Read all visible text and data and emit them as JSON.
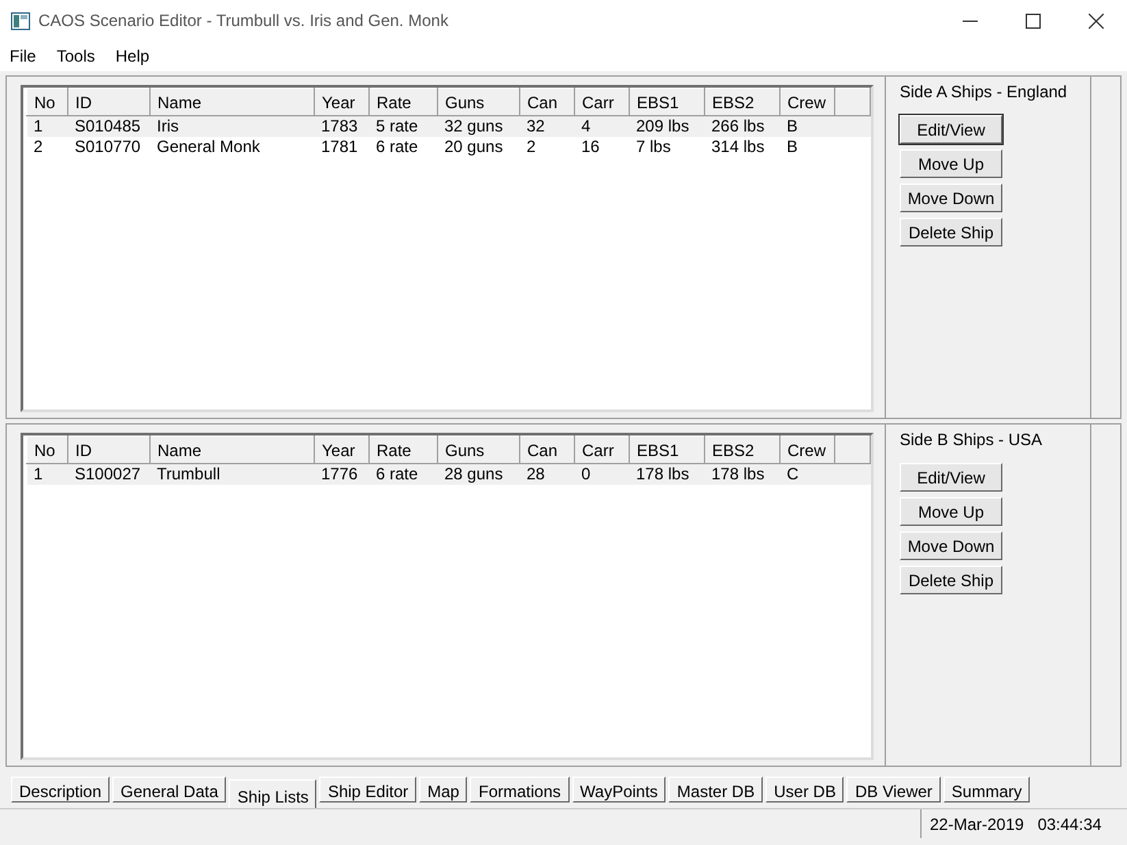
{
  "window": {
    "title": "CAOS Scenario Editor - Trumbull vs. Iris and Gen. Monk"
  },
  "menu": [
    "File",
    "Tools",
    "Help"
  ],
  "sides": [
    {
      "title": "Side A Ships - England",
      "columns": [
        "No",
        "ID",
        "Name",
        "Year",
        "Rate",
        "Guns",
        "Can",
        "Carr",
        "EBS1",
        "EBS2",
        "Crew"
      ],
      "rows": [
        {
          "selected": true,
          "cells": [
            "1",
            "S010485",
            "Iris",
            "1783",
            "5 rate",
            "32 guns",
            "32",
            "4",
            "209 lbs",
            "266 lbs",
            "B"
          ]
        },
        {
          "selected": false,
          "cells": [
            "2",
            "S010770",
            "General Monk",
            "1781",
            "6 rate",
            "20 guns",
            "2",
            "16",
            "7 lbs",
            "314 lbs",
            "B"
          ]
        }
      ],
      "buttons": [
        {
          "label": "Edit/View",
          "focused": true
        },
        {
          "label": "Move Up",
          "focused": false
        },
        {
          "label": "Move Down",
          "focused": false
        },
        {
          "label": "Delete Ship",
          "focused": false
        }
      ]
    },
    {
      "title": "Side B Ships - USA",
      "columns": [
        "No",
        "ID",
        "Name",
        "Year",
        "Rate",
        "Guns",
        "Can",
        "Carr",
        "EBS1",
        "EBS2",
        "Crew"
      ],
      "rows": [
        {
          "selected": true,
          "cells": [
            "1",
            "S100027",
            "Trumbull",
            "1776",
            "6 rate",
            "28 guns",
            "28",
            "0",
            "178 lbs",
            "178 lbs",
            "C"
          ]
        }
      ],
      "buttons": [
        {
          "label": "Edit/View",
          "focused": false
        },
        {
          "label": "Move Up",
          "focused": false
        },
        {
          "label": "Move Down",
          "focused": false
        },
        {
          "label": "Delete Ship",
          "focused": false
        }
      ]
    }
  ],
  "tabs": [
    {
      "label": "Description",
      "selected": false
    },
    {
      "label": "General Data",
      "selected": false
    },
    {
      "label": "Ship Lists",
      "selected": true
    },
    {
      "label": "Ship Editor",
      "selected": false
    },
    {
      "label": "Map",
      "selected": false
    },
    {
      "label": "Formations",
      "selected": false
    },
    {
      "label": "WayPoints",
      "selected": false
    },
    {
      "label": "Master DB",
      "selected": false
    },
    {
      "label": "User DB",
      "selected": false
    },
    {
      "label": "DB Viewer",
      "selected": false
    },
    {
      "label": "Summary",
      "selected": false
    }
  ],
  "status_bar": {
    "date": "22-Mar-2019",
    "time": "03:44:34"
  }
}
